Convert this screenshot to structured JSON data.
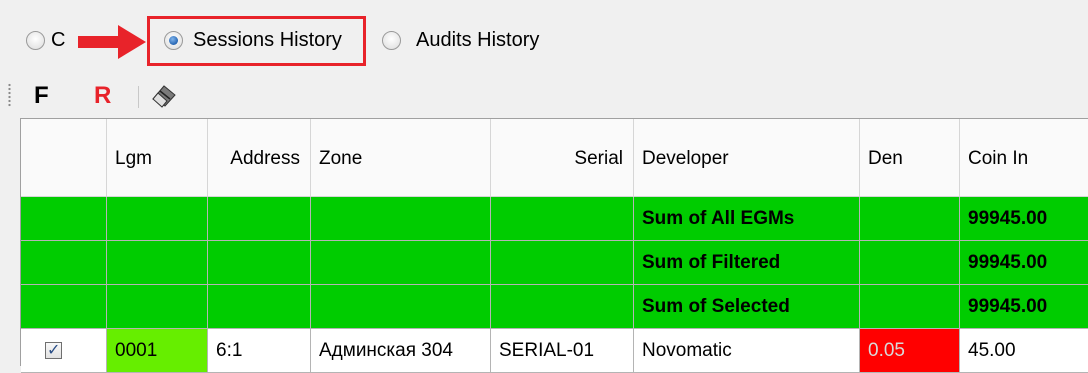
{
  "radio_options": {
    "first_partial_label": "C",
    "sessions_label": "Sessions History",
    "audits_label": "Audits History",
    "selected": "Sessions History"
  },
  "toolbar": {
    "f_label": "F",
    "r_label": "R",
    "f_color": "#000000",
    "r_color": "#e8232a",
    "eraser_icon": "eraser-icon"
  },
  "colors": {
    "sum_row_bg": "#00cc00",
    "lgm_highlight": "#66ee00",
    "den_highlight": "#ff0000",
    "annotation_red": "#e8232a"
  },
  "grid": {
    "columns": [
      "",
      "Lgm",
      "Address",
      "Zone",
      "Serial",
      "Developer",
      "Den",
      "Coin In"
    ],
    "sum_rows": [
      {
        "label": "Sum of All EGMs",
        "coin_in": "99945.00"
      },
      {
        "label": "Sum of Filtered",
        "coin_in": "99945.00"
      },
      {
        "label": "Sum of Selected",
        "coin_in": "99945.00"
      }
    ],
    "rows": [
      {
        "checked": true,
        "lgm": "0001",
        "address": "6:1",
        "zone": "Админская 304",
        "serial": "SERIAL-01",
        "developer": "Novomatic",
        "den": "0.05",
        "coin_in": "45.00"
      }
    ]
  }
}
